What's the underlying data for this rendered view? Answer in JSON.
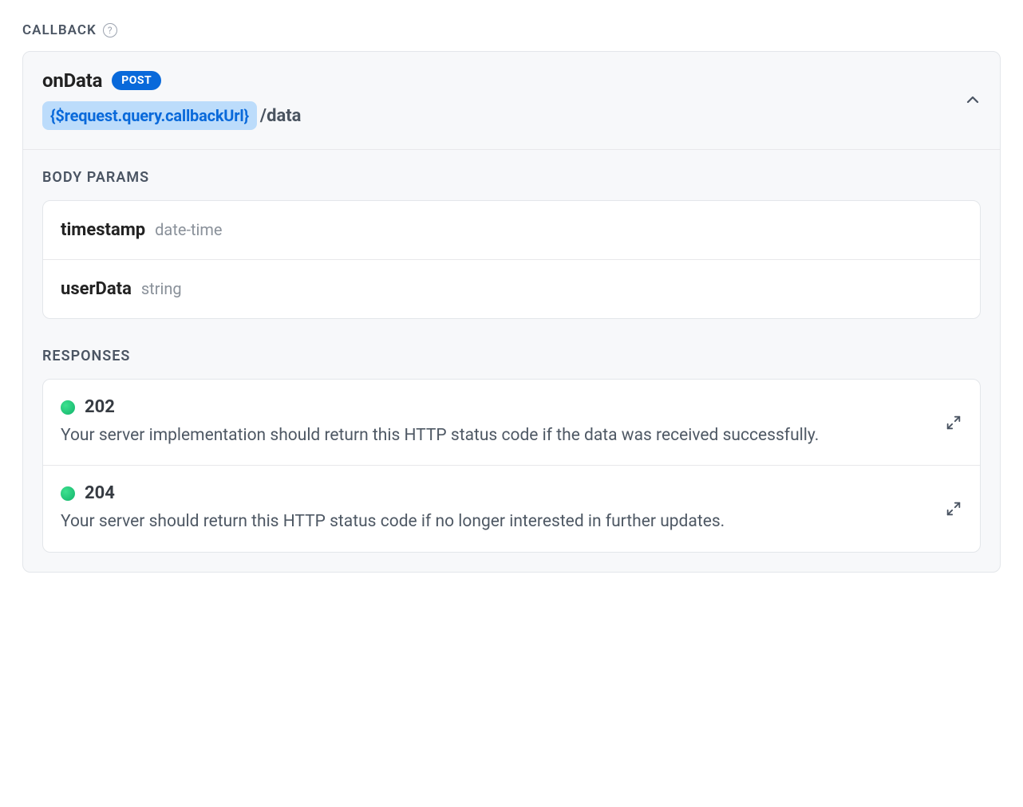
{
  "section": {
    "label": "CALLBACK"
  },
  "callback": {
    "name": "onData",
    "method": "POST",
    "url_variable": "{$request.query.callbackUrl}",
    "url_path": "/data"
  },
  "body_params": {
    "label": "BODY PARAMS",
    "items": [
      {
        "name": "timestamp",
        "type": "date-time"
      },
      {
        "name": "userData",
        "type": "string"
      }
    ]
  },
  "responses": {
    "label": "RESPONSES",
    "items": [
      {
        "code": "202",
        "status_color": "#12b36b",
        "description": "Your server implementation should return this HTTP status code if the data was received successfully."
      },
      {
        "code": "204",
        "status_color": "#12b36b",
        "description": "Your server should return this HTTP status code if no longer interested in further updates."
      }
    ]
  }
}
